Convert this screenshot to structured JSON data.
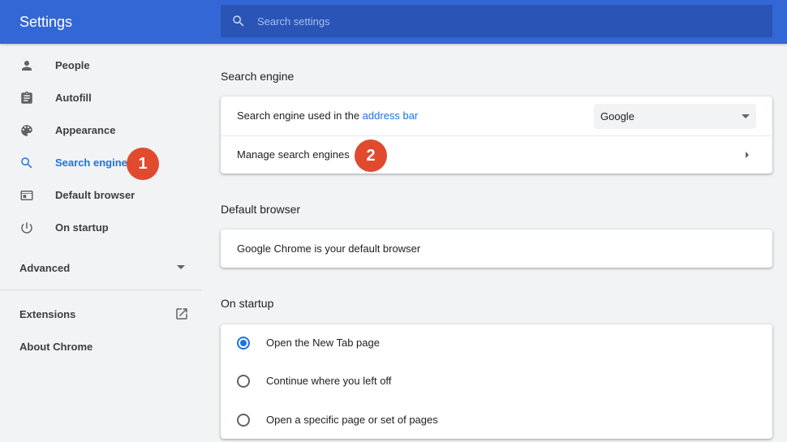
{
  "header": {
    "title": "Settings",
    "search_placeholder": "Search settings"
  },
  "sidebar": {
    "items": [
      {
        "label": "People",
        "icon": "person-icon"
      },
      {
        "label": "Autofill",
        "icon": "clipboard-icon"
      },
      {
        "label": "Appearance",
        "icon": "palette-icon"
      },
      {
        "label": "Search engine",
        "icon": "search-icon",
        "active": true
      },
      {
        "label": "Default browser",
        "icon": "browser-window-icon"
      },
      {
        "label": "On startup",
        "icon": "power-icon"
      }
    ],
    "advanced_label": "Advanced",
    "extensions_label": "Extensions",
    "about_label": "About Chrome"
  },
  "badges": {
    "first": "1",
    "second": "2"
  },
  "sections": {
    "search_engine": {
      "title": "Search engine",
      "used_in_text": "Search engine used in the ",
      "used_in_link": "address bar",
      "selected_engine": "Google",
      "manage_label": "Manage search engines"
    },
    "default_browser": {
      "title": "Default browser",
      "status_text": "Google Chrome is your default browser"
    },
    "on_startup": {
      "title": "On startup",
      "options": [
        {
          "label": "Open the New Tab page",
          "checked": true
        },
        {
          "label": "Continue where you left off",
          "checked": false
        },
        {
          "label": "Open a specific page or set of pages",
          "checked": false
        }
      ]
    }
  },
  "colors": {
    "header": "#3367d6",
    "accent": "#1a73e8",
    "badge": "#e04a2f",
    "background": "#f1f3f4"
  }
}
